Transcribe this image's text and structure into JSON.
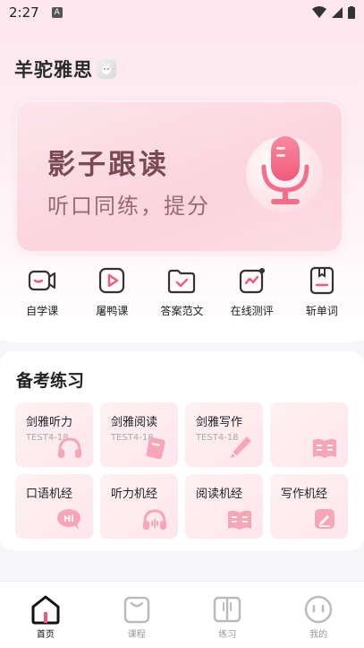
{
  "status": {
    "time": "2:27",
    "notif": "A"
  },
  "app": {
    "title": "羊驼雅思"
  },
  "hero": {
    "title": "影子跟读",
    "subtitle": "听口同练，提分"
  },
  "menu": [
    {
      "label": "自学课",
      "icon": "video-camera-icon"
    },
    {
      "label": "屠鸭课",
      "icon": "play-video-icon"
    },
    {
      "label": "答案范文",
      "icon": "folder-check-icon"
    },
    {
      "label": "在线测评",
      "icon": "chart-test-icon"
    },
    {
      "label": "斩单词",
      "icon": "vocabulary-book-icon"
    }
  ],
  "practice": {
    "title": "备考练习",
    "tiles": [
      {
        "title": "剑雅听力",
        "sub": "TEST4-18",
        "icon": "headphones-icon"
      },
      {
        "title": "剑雅阅读",
        "sub": "TEST4-18",
        "icon": "book-icon"
      },
      {
        "title": "剑雅写作",
        "sub": "TEST4-18",
        "icon": "pen-icon"
      },
      {
        "title": "",
        "sub": "",
        "icon": "open-book-icon"
      },
      {
        "title": "口语机经",
        "sub": "",
        "icon": "speech-bubble-hi-icon"
      },
      {
        "title": "听力机经",
        "sub": "",
        "icon": "headphones-icon"
      },
      {
        "title": "阅读机经",
        "sub": "",
        "icon": "open-book-icon"
      },
      {
        "title": "写作机经",
        "sub": "",
        "icon": "edit-icon"
      }
    ]
  },
  "tabs": [
    {
      "label": "首页",
      "active": true
    },
    {
      "label": "课程",
      "active": false
    },
    {
      "label": "练习",
      "active": false
    },
    {
      "label": "我的",
      "active": false
    }
  ],
  "colors": {
    "accent": "#f05a7a",
    "pink_light": "#fde6ec",
    "text_dark": "#222222"
  }
}
